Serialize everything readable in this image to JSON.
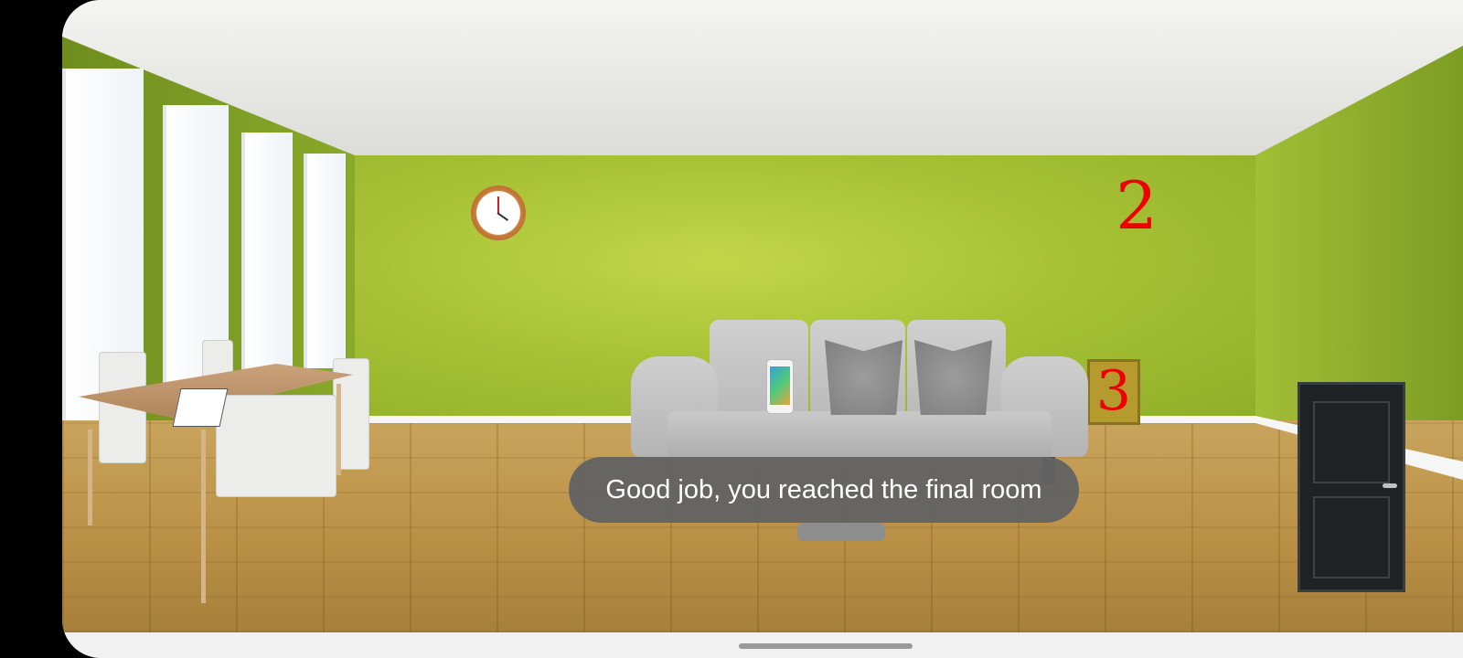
{
  "scene": {
    "clue_number_wall": "2",
    "clue_number_frame": "3",
    "message": "Good job, you reached the final room"
  },
  "icons": {
    "clock": "wall-clock-icon",
    "phone": "smartphone-icon",
    "door": "exit-door-icon",
    "notepad": "notepad-icon"
  },
  "colors": {
    "wall_green": "#a8c236",
    "clue_red": "#e00000",
    "toast_bg": "#626262"
  }
}
